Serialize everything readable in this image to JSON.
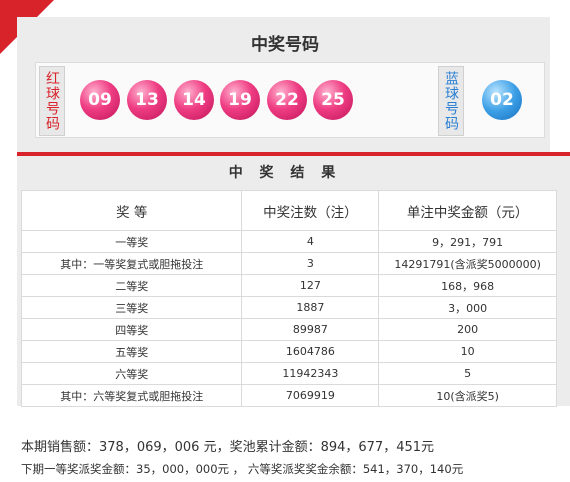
{
  "header": {
    "title": "中奖号码"
  },
  "red_label": "红球号码",
  "blue_label": "蓝球号码",
  "red_balls": [
    "09",
    "13",
    "14",
    "19",
    "22",
    "25"
  ],
  "blue_ball": "02",
  "colors": {
    "accent": "#d8232a",
    "red_ball": "#ef3d83",
    "blue_ball": "#3c9fe6"
  },
  "results": {
    "title": "中 奖 结 果",
    "columns": [
      "奖  等",
      "中奖注数（注）",
      "单注中奖金额（元）"
    ],
    "rows": [
      [
        "一等奖",
        "4",
        "9，291，791"
      ],
      [
        "其中：一等奖复式或胆拖投注",
        "3",
        "14291791(含派奖5000000)"
      ],
      [
        "二等奖",
        "127",
        "168，968"
      ],
      [
        "三等奖",
        "1887",
        "3，000"
      ],
      [
        "四等奖",
        "89987",
        "200"
      ],
      [
        "五等奖",
        "1604786",
        "10"
      ],
      [
        "六等奖",
        "11942343",
        "5"
      ],
      [
        "其中：六等奖复式或胆拖投注",
        "7069919",
        "10(含派奖5)"
      ]
    ]
  },
  "summary": {
    "line1": "本期销售额：378，069，006 元，奖池累计金额：894，677，451元",
    "line2": "下期一等奖派奖金额：35，000，000元 ，  六等奖派奖奖金余额：541，370，140元"
  }
}
